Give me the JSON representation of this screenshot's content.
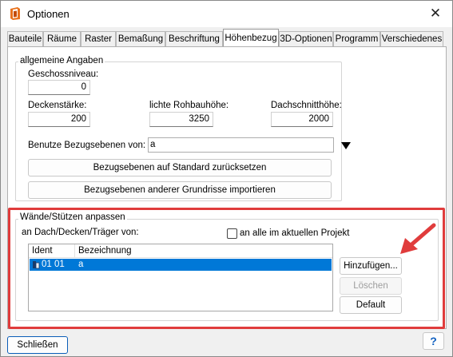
{
  "window": {
    "title": "Optionen",
    "close_glyph": "✕"
  },
  "tabs": [
    {
      "label": "Bauteile"
    },
    {
      "label": "Räume"
    },
    {
      "label": "Raster"
    },
    {
      "label": "Bemaßung"
    },
    {
      "label": "Beschriftung"
    },
    {
      "label": "Höhenbezug",
      "active": true
    },
    {
      "label": "3D-Optionen"
    },
    {
      "label": "Programm"
    },
    {
      "label": "Verschiedenes"
    }
  ],
  "general": {
    "group_label": "allgemeine Angaben",
    "geschossniveau_label": "Geschossniveau:",
    "geschossniveau_value": "0",
    "deckenstaerke_label": "Deckenstärke:",
    "deckenstaerke_value": "200",
    "rohbauhoehe_label": "lichte Rohbauhöhe:",
    "rohbauhoehe_value": "3250",
    "dachschnitt_label": "Dachschnitthöhe:",
    "dachschnitt_value": "2000",
    "bezugsebenen_label": "Benutze Bezugsebenen von:",
    "bezugsebenen_value": "a",
    "reset_button": "Bezugsebenen auf Standard zurücksetzen",
    "import_button": "Bezugsebenen anderer Grundrisse importieren"
  },
  "walls": {
    "group_label": "Wände/Stützen anpassen",
    "sub_label": "an Dach/Decken/Träger von:",
    "checkbox_label": "an alle im aktuellen Projekt",
    "checkbox_checked": false,
    "columns": [
      "Ident",
      "Bezeichnung"
    ],
    "rows": [
      {
        "ident": "01 01",
        "bezeichnung": "a",
        "selected": true
      }
    ],
    "add_button": "Hinzufügen...",
    "delete_button": "Löschen",
    "default_button": "Default"
  },
  "footer": {
    "close_button": "Schließen",
    "help_button": "?"
  },
  "colors": {
    "selection": "#0078d7",
    "annotation": "#e03c3c",
    "app_icon": "#e8711c"
  },
  "icons": {
    "app": "app-icon",
    "dropdown": "triangle-down-icon",
    "row": "wall-icon",
    "arrow": "red-arrow-annotation"
  }
}
